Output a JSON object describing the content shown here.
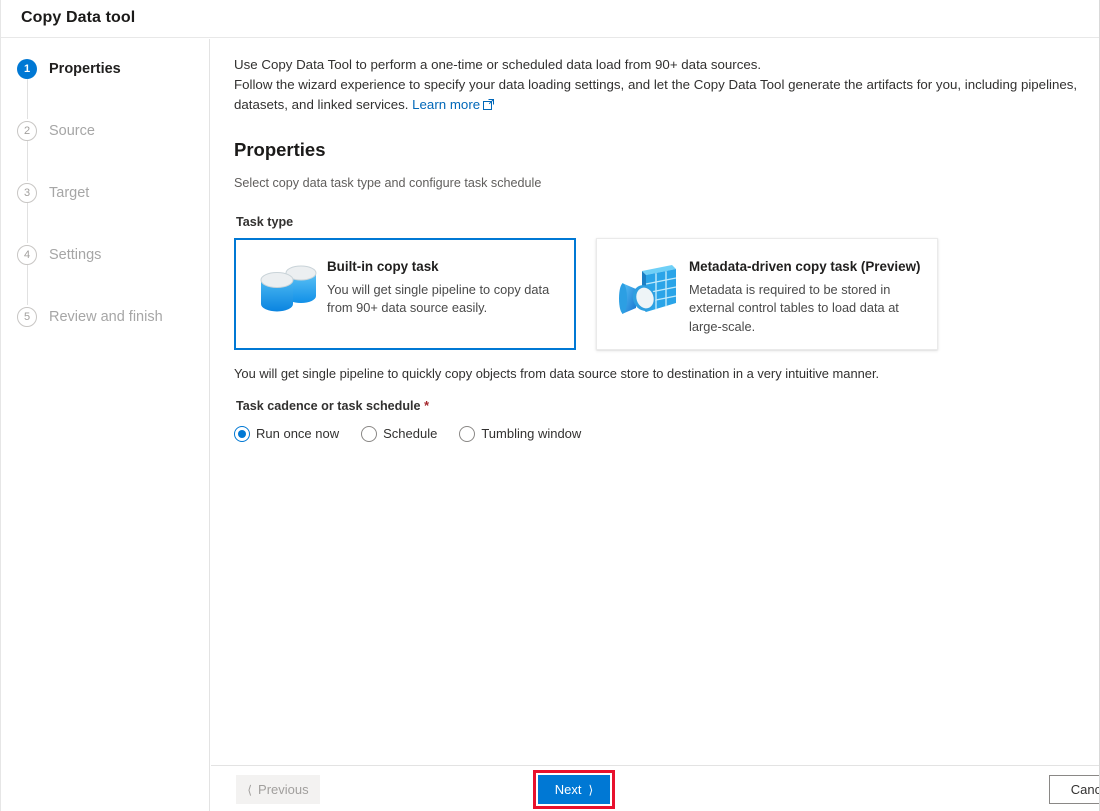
{
  "window": {
    "title": "Copy Data tool"
  },
  "sidebar": {
    "steps": [
      {
        "number": "1",
        "label": "Properties",
        "state": "active"
      },
      {
        "number": "2",
        "label": "Source",
        "state": "inactive"
      },
      {
        "number": "3",
        "label": "Target",
        "state": "inactive"
      },
      {
        "number": "4",
        "label": "Settings",
        "state": "inactive"
      },
      {
        "number": "5",
        "label": "Review and finish",
        "state": "inactive"
      }
    ]
  },
  "content": {
    "intro_line1": "Use Copy Data Tool to perform a one-time or scheduled data load from 90+ data sources.",
    "intro_line2": "Follow the wizard experience to specify your data loading settings, and let the Copy Data Tool generate the artifacts for you, including pipelines, datasets, and linked services.",
    "learn_more_label": "Learn more",
    "section_title": "Properties",
    "section_subtitle": "Select copy data task type and configure task schedule",
    "task_type_label": "Task type",
    "task_types": [
      {
        "title": "Built-in copy task",
        "description": "You will get single pipeline to copy data from 90+ data source easily.",
        "icon": "database-cylinders-icon",
        "selected": true
      },
      {
        "title": "Metadata-driven copy task (Preview)",
        "description": "Metadata is required to be stored in external control tables to load data at large-scale.",
        "icon": "metadata-table-search-icon",
        "selected": false
      }
    ],
    "task_type_note": "You will get single pipeline to quickly copy objects from data source store to destination in a very intuitive manner.",
    "cadence_label": "Task cadence or task schedule",
    "cadence_required_marker": "*",
    "cadence_options": [
      {
        "label": "Run once now",
        "checked": true
      },
      {
        "label": "Schedule",
        "checked": false
      },
      {
        "label": "Tumbling window",
        "checked": false
      }
    ]
  },
  "footer": {
    "previous_label": "Previous",
    "next_label": "Next",
    "cancel_label": "Cancel"
  },
  "colors": {
    "accent": "#0078d4",
    "link": "#0067b8",
    "annotation": "#e8112d",
    "required": "#a4262c"
  }
}
